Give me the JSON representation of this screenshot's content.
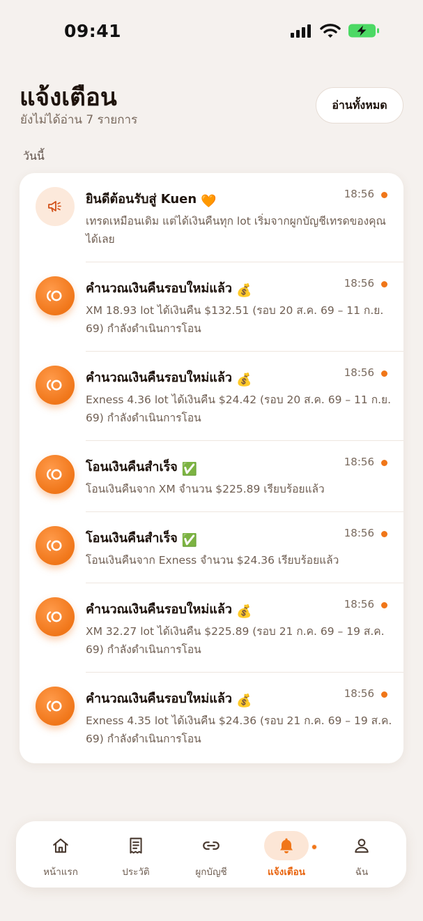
{
  "status_bar": {
    "time": "09:41"
  },
  "header": {
    "title": "แจ้งเตือน",
    "subtitle": "ยังไม่ได้อ่าน 7 รายการ",
    "read_all_label": "อ่านทั้งหมด"
  },
  "section": {
    "label": "วันนี้"
  },
  "notifications": [
    {
      "title": "ยินดีต้อนรับสู่ Kuen",
      "emoji": "🧡",
      "time": "18:56",
      "unread": true,
      "icon": "megaphone-icon",
      "body": "เทรดเหมือนเดิม แต่ได้เงินคืนทุก lot เริ่มจากผูกบัญชีเทรดของคุณได้เลย"
    },
    {
      "title": "คำนวณเงินคืนรอบใหม่แล้ว",
      "emoji": "💰",
      "time": "18:56",
      "unread": true,
      "icon": "kuen-logo-icon",
      "body": "XM 18.93 lot ได้เงินคืน $132.51 (รอบ 20 ส.ค. 69 – 11 ก.ย. 69) กำลังดำเนินการโอน"
    },
    {
      "title": "คำนวณเงินคืนรอบใหม่แล้ว",
      "emoji": "💰",
      "time": "18:56",
      "unread": true,
      "icon": "kuen-logo-icon",
      "body": "Exness 4.36 lot ได้เงินคืน $24.42 (รอบ 20 ส.ค. 69 – 11 ก.ย. 69) กำลังดำเนินการโอน"
    },
    {
      "title": "โอนเงินคืนสำเร็จ",
      "emoji": "✅",
      "time": "18:56",
      "unread": true,
      "icon": "kuen-logo-icon",
      "body": "โอนเงินคืนจาก XM จำนวน $225.89 เรียบร้อยแล้ว"
    },
    {
      "title": "โอนเงินคืนสำเร็จ",
      "emoji": "✅",
      "time": "18:56",
      "unread": true,
      "icon": "kuen-logo-icon",
      "body": "โอนเงินคืนจาก Exness จำนวน $24.36 เรียบร้อยแล้ว"
    },
    {
      "title": "คำนวณเงินคืนรอบใหม่แล้ว",
      "emoji": "💰",
      "time": "18:56",
      "unread": true,
      "icon": "kuen-logo-icon",
      "body": "XM 32.27 lot ได้เงินคืน $225.89 (รอบ 21 ก.ค. 69 – 19 ส.ค. 69) กำลังดำเนินการโอน"
    },
    {
      "title": "คำนวณเงินคืนรอบใหม่แล้ว",
      "emoji": "💰",
      "time": "18:56",
      "unread": true,
      "icon": "kuen-logo-icon",
      "body": "Exness 4.35 lot ได้เงินคืน $24.36 (รอบ 21 ก.ค. 69 – 19 ส.ค. 69) กำลังดำเนินการโอน"
    }
  ],
  "nav": {
    "active": "แจ้งเตือน",
    "items": [
      {
        "label": "หน้าแรก",
        "icon": "home-icon"
      },
      {
        "label": "ประวัติ",
        "icon": "receipt-icon"
      },
      {
        "label": "ผูกบัญชี",
        "icon": "link-icon"
      },
      {
        "label": "แจ้งเตือน",
        "icon": "bell-icon"
      },
      {
        "label": "ฉัน",
        "icon": "user-icon"
      }
    ]
  },
  "colors": {
    "background": "#F5F1EE",
    "accent": "#F07619",
    "accent_soft": "#FCE6D6",
    "text_primary": "#1E130C",
    "text_secondary": "#6F5E52"
  }
}
